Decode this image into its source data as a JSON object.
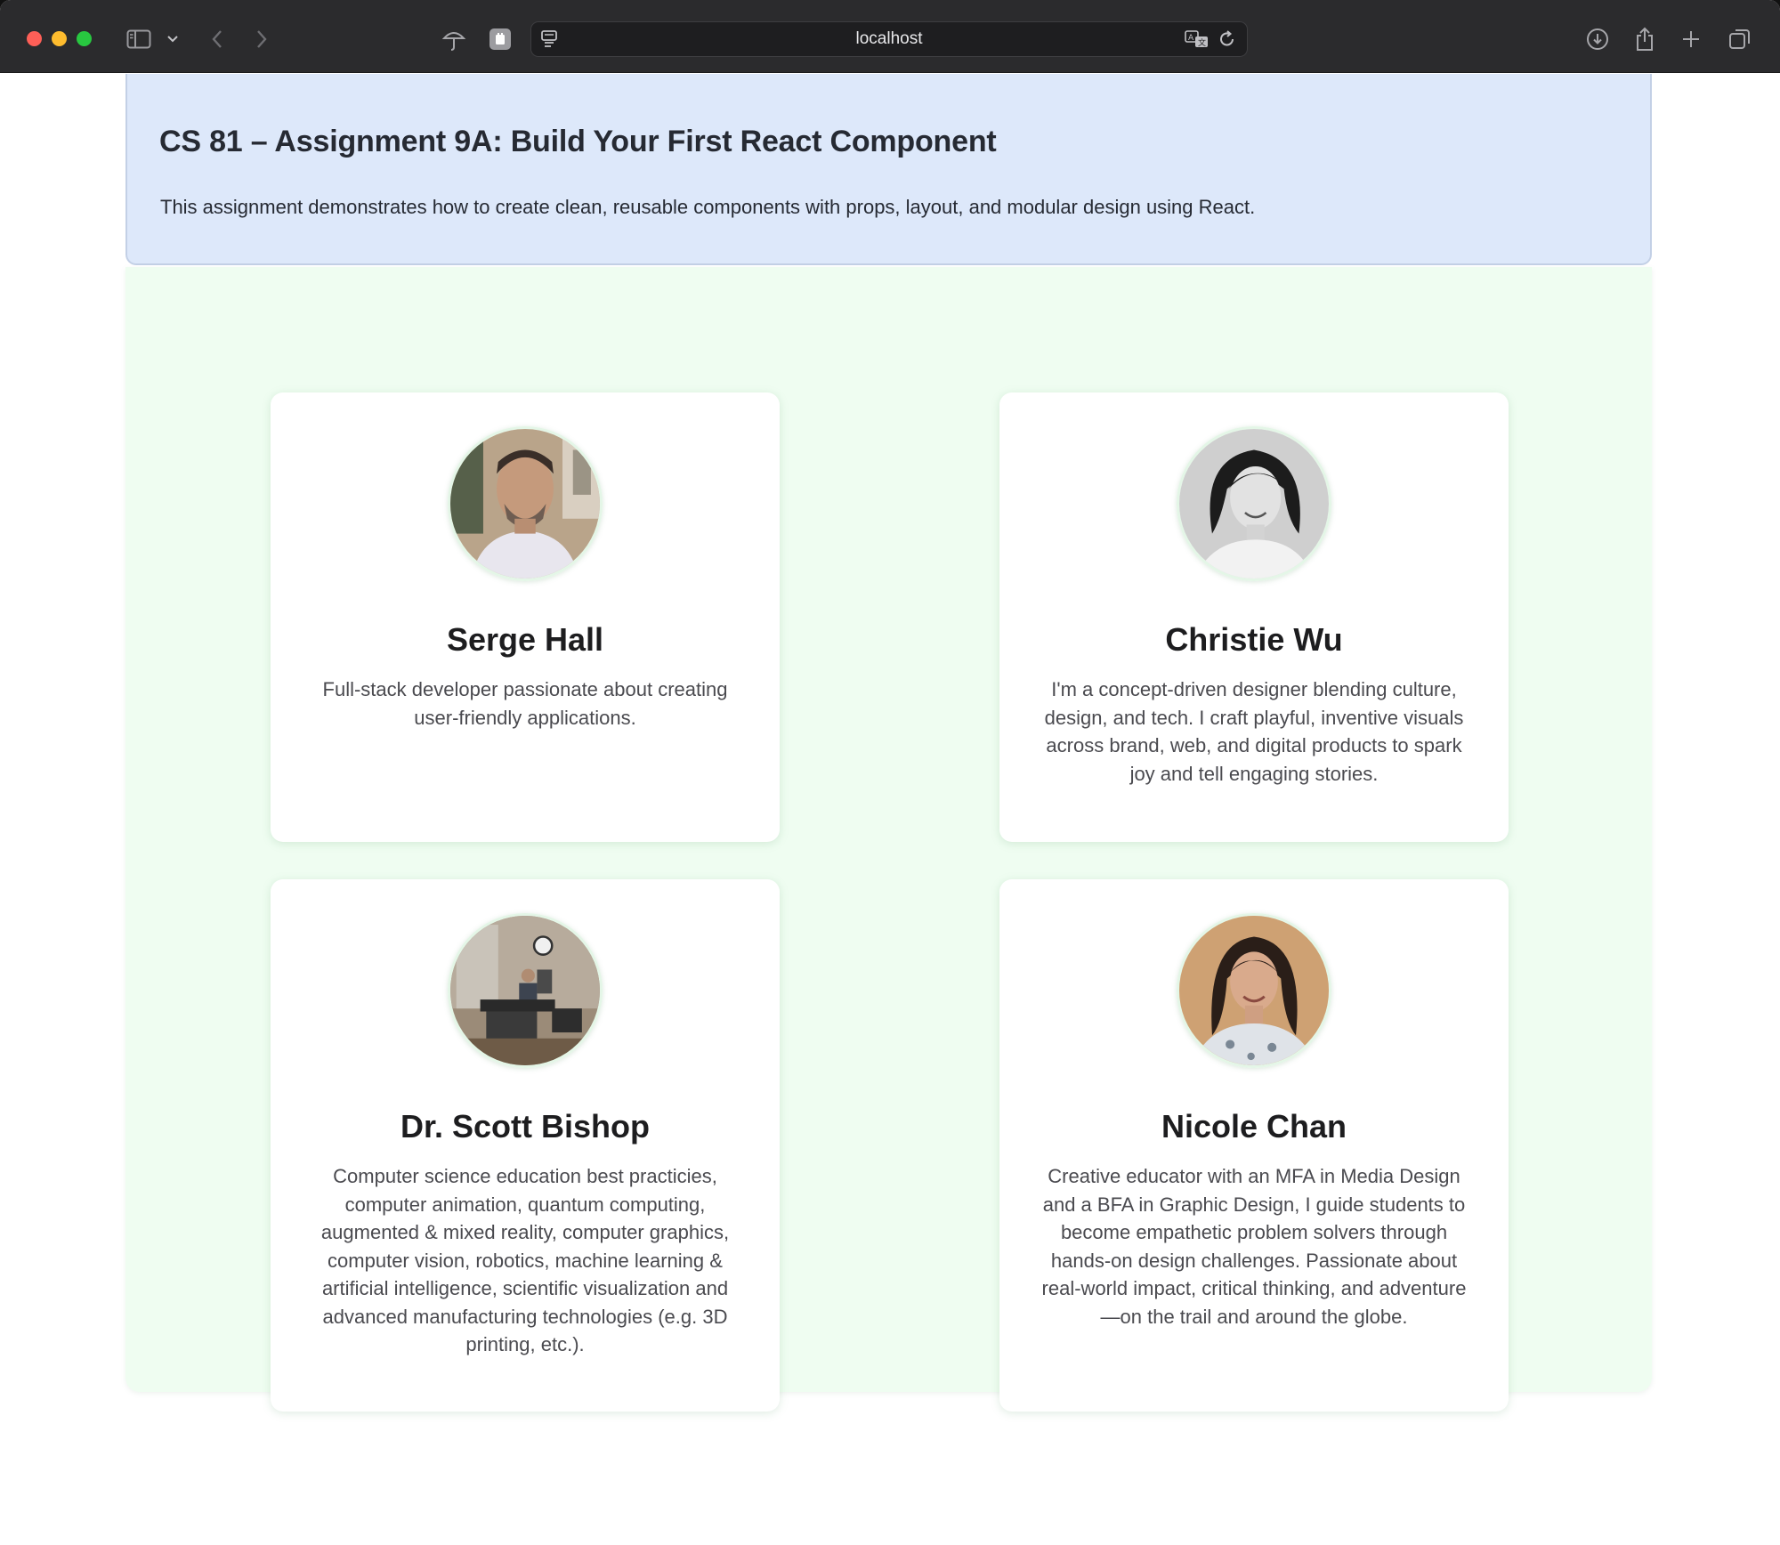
{
  "browser": {
    "address": "localhost"
  },
  "header": {
    "title": "CS 81 – Assignment 9A: Build Your First React Component",
    "description": "This assignment demonstrates how to create clean, reusable components with props, layout, and modular design using React."
  },
  "cards": [
    {
      "name": "Serge Hall",
      "bio": "Full-stack developer passionate about creating user-friendly applications."
    },
    {
      "name": "Christie Wu",
      "bio": "I'm a concept-driven designer blending culture, design, and tech. I craft playful, inventive visuals across brand, web, and digital products to spark joy and tell engaging stories."
    },
    {
      "name": "Dr. Scott Bishop",
      "bio": "Computer science education best practicies, computer animation, quantum computing, augmented & mixed reality, computer graphics, computer vision, robotics, machine learning & artificial intelligence, scientific visualization and advanced manufacturing technologies (e.g. 3D printing, etc.)."
    },
    {
      "name": "Nicole Chan",
      "bio": "Creative educator with an MFA in Media Design and a BFA in Graphic Design, I guide students to become empathetic problem solvers through hands-on design challenges. Passionate about real-world impact, critical thinking, and adventure—on the trail and around the globe."
    }
  ],
  "colors": {
    "header_bg": "#dde8fa",
    "grid_bg": "#effdf1",
    "card_bg": "#ffffff",
    "toolbar_bg": "#2b2b2d"
  }
}
